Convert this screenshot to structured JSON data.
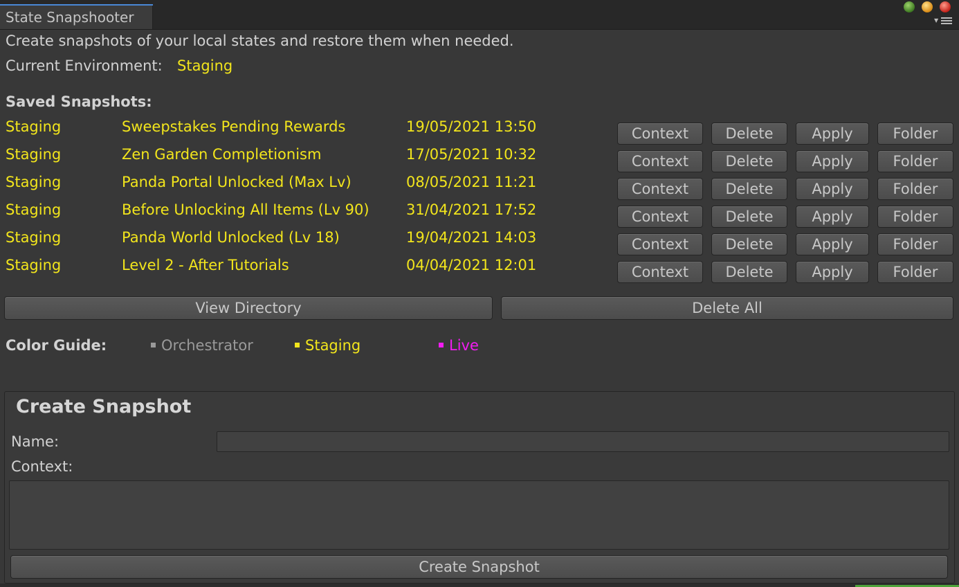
{
  "window": {
    "tab_title": "State Snapshooter"
  },
  "header": {
    "description": "Create snapshots of your local states and restore them when needed.",
    "current_env_label": "Current Environment:",
    "current_env_value": "Staging"
  },
  "snapshots": {
    "heading": "Saved Snapshots:",
    "button_labels": {
      "context": "Context",
      "delete": "Delete",
      "apply": "Apply",
      "folder": "Folder"
    },
    "rows": [
      {
        "env": "Staging",
        "name": "Sweepstakes Pending Rewards",
        "date": "19/05/2021 13:50"
      },
      {
        "env": "Staging",
        "name": "Zen Garden Completionism",
        "date": "17/05/2021 10:32"
      },
      {
        "env": "Staging",
        "name": "Panda Portal Unlocked (Max Lv)",
        "date": "08/05/2021 11:21"
      },
      {
        "env": "Staging",
        "name": "Before Unlocking All Items (Lv 90)",
        "date": "31/04/2021 17:52"
      },
      {
        "env": "Staging",
        "name": "Panda World Unlocked (Lv 18)",
        "date": "19/04/2021 14:03"
      },
      {
        "env": "Staging",
        "name": "Level 2 - After Tutorials",
        "date": "04/04/2021 12:01"
      }
    ]
  },
  "actions": {
    "view_directory": "View Directory",
    "delete_all": "Delete All"
  },
  "color_guide": {
    "label": "Color Guide:",
    "items": [
      {
        "label": "Orchestrator",
        "color": "#9a9a9a"
      },
      {
        "label": "Staging",
        "color": "#f2e51c"
      },
      {
        "label": "Live",
        "color": "#f21cf2"
      }
    ]
  },
  "create": {
    "title": "Create Snapshot",
    "name_label": "Name:",
    "name_value": "",
    "context_label": "Context:",
    "context_value": "",
    "submit_label": "Create Snapshot"
  },
  "colors": {
    "background": "#383838",
    "staging": "#f2e51c",
    "live": "#f21cf2",
    "orchestrator": "#9a9a9a",
    "tab_accent": "#4a88d6"
  }
}
